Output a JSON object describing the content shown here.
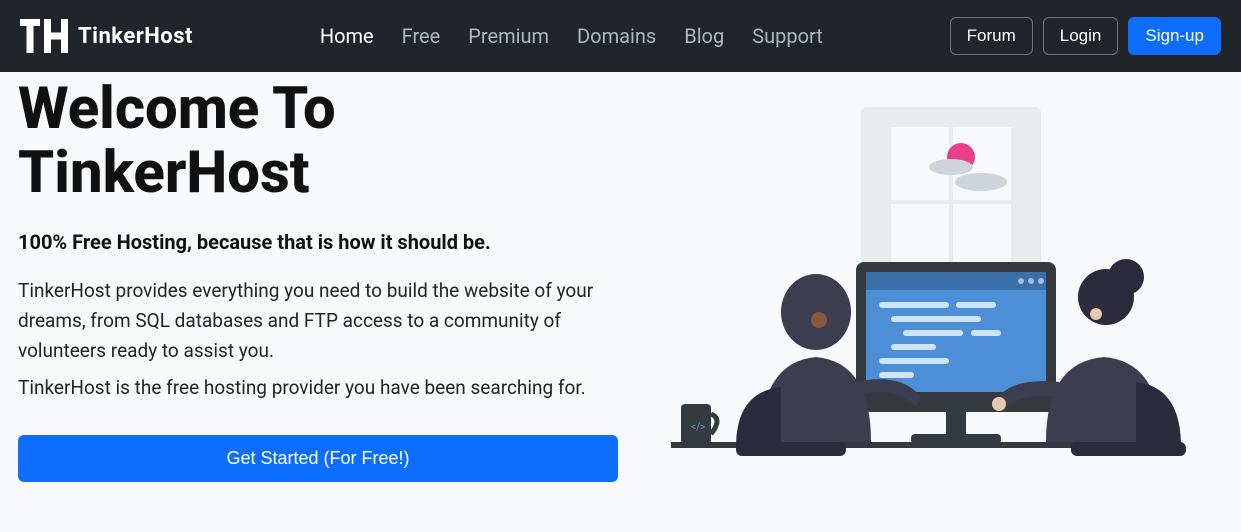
{
  "brand": {
    "name": "TinkerHost"
  },
  "nav": {
    "links": [
      "Home",
      "Free",
      "Premium",
      "Domains",
      "Blog",
      "Support"
    ],
    "active": "Home",
    "actions": {
      "forum": "Forum",
      "login": "Login",
      "signup": "Sign-up"
    }
  },
  "hero": {
    "title": "Welcome To TinkerHost",
    "subtitle": "100% Free Hosting, because that is how it should be.",
    "desc1": "TinkerHost provides everything you need to build the website of your dreams, from SQL databases and FTP access to a community of volunteers ready to assist you.",
    "desc2": "TinkerHost is the free hosting provider you have been searching for.",
    "cta": "Get Started (For Free!)"
  },
  "colors": {
    "primary": "#0d6efd",
    "navbar": "#212529",
    "muted": "#adb5bd"
  }
}
